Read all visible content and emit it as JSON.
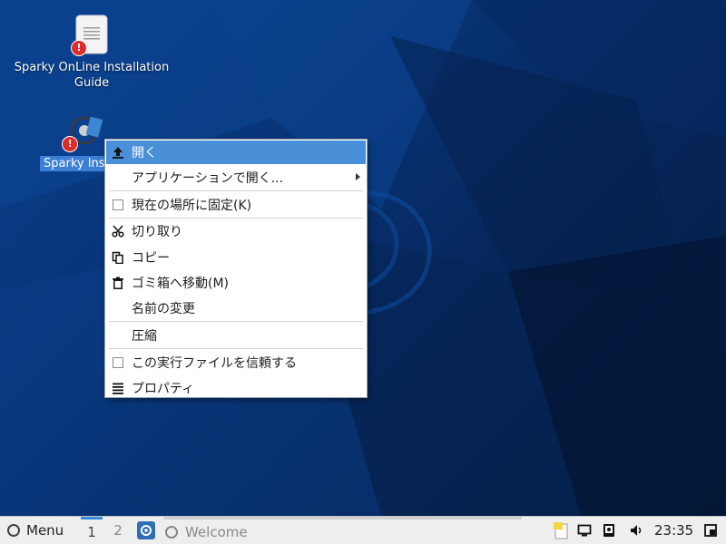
{
  "desktop": {
    "icons": [
      {
        "label": "Sparky OnLine Installation Guide",
        "icon": "document-icon"
      },
      {
        "label": "Sparky Installer",
        "icon": "sparky-installer-icon",
        "selected": true
      }
    ],
    "warning_badge": "!"
  },
  "context_menu": {
    "items": [
      {
        "label": "開く",
        "icon": "open-icon"
      },
      {
        "label": "アプリケーションで開く...",
        "submenu": true
      },
      {
        "label": "現在の場所に固定(K)",
        "icon": "checkbox"
      },
      {
        "label": "切り取り",
        "icon": "scissors-icon"
      },
      {
        "label": "コピー",
        "icon": "copy-icon"
      },
      {
        "label": "ゴミ箱へ移動(M)",
        "icon": "trash-icon"
      },
      {
        "label": "名前の変更"
      },
      {
        "label": "圧縮"
      },
      {
        "label": "この実行ファイルを信頼する",
        "icon": "checkbox"
      },
      {
        "label": "プロパティ",
        "icon": "properties-icon"
      }
    ]
  },
  "taskbar": {
    "menu_label": "Menu",
    "workspaces": [
      "1",
      "2"
    ],
    "window_title": "Welcome",
    "clock": "23:35"
  },
  "colors": {
    "highlight": "#4a90d9",
    "desktop": "#083477"
  }
}
